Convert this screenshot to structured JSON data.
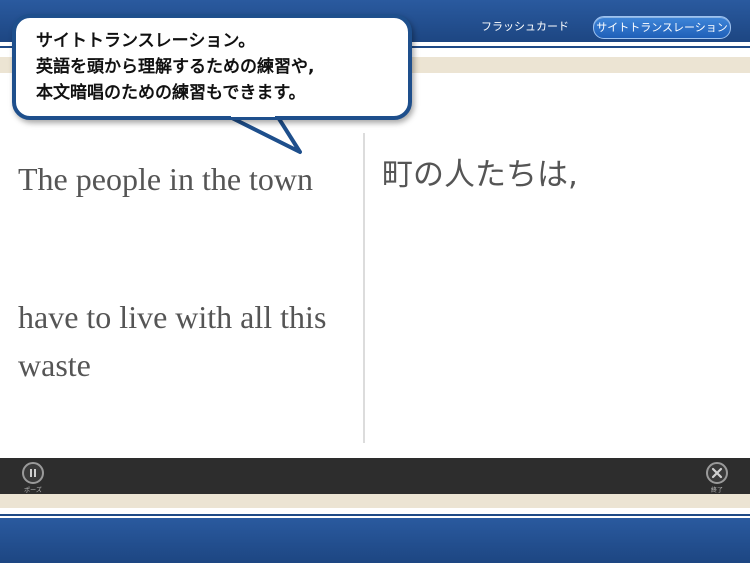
{
  "header": {
    "tabs": [
      {
        "label": "フラッシュカード",
        "active": false
      },
      {
        "label": "サイトトランスレーション",
        "active": true
      }
    ]
  },
  "callout": {
    "lines": [
      "サイトトランスレーション。",
      "英語を頭から理解するための練習や,",
      "本文暗唱のための練習もできます。"
    ]
  },
  "content": {
    "english": [
      "The people in the town",
      "have to live with all this waste"
    ],
    "japanese": "町の人たちは,"
  },
  "toolbar": {
    "pause_label": "ポーズ",
    "end_label": "終了"
  },
  "icons": {
    "settings": "wrench-icon",
    "pause": "pause-icon",
    "close": "close-icon"
  },
  "colors": {
    "header_blue": "#1d4682",
    "accent_blue": "#1f5fb8",
    "beige": "#ece4d3",
    "toolbar": "#2d2d2d",
    "text_gray": "#555555"
  }
}
